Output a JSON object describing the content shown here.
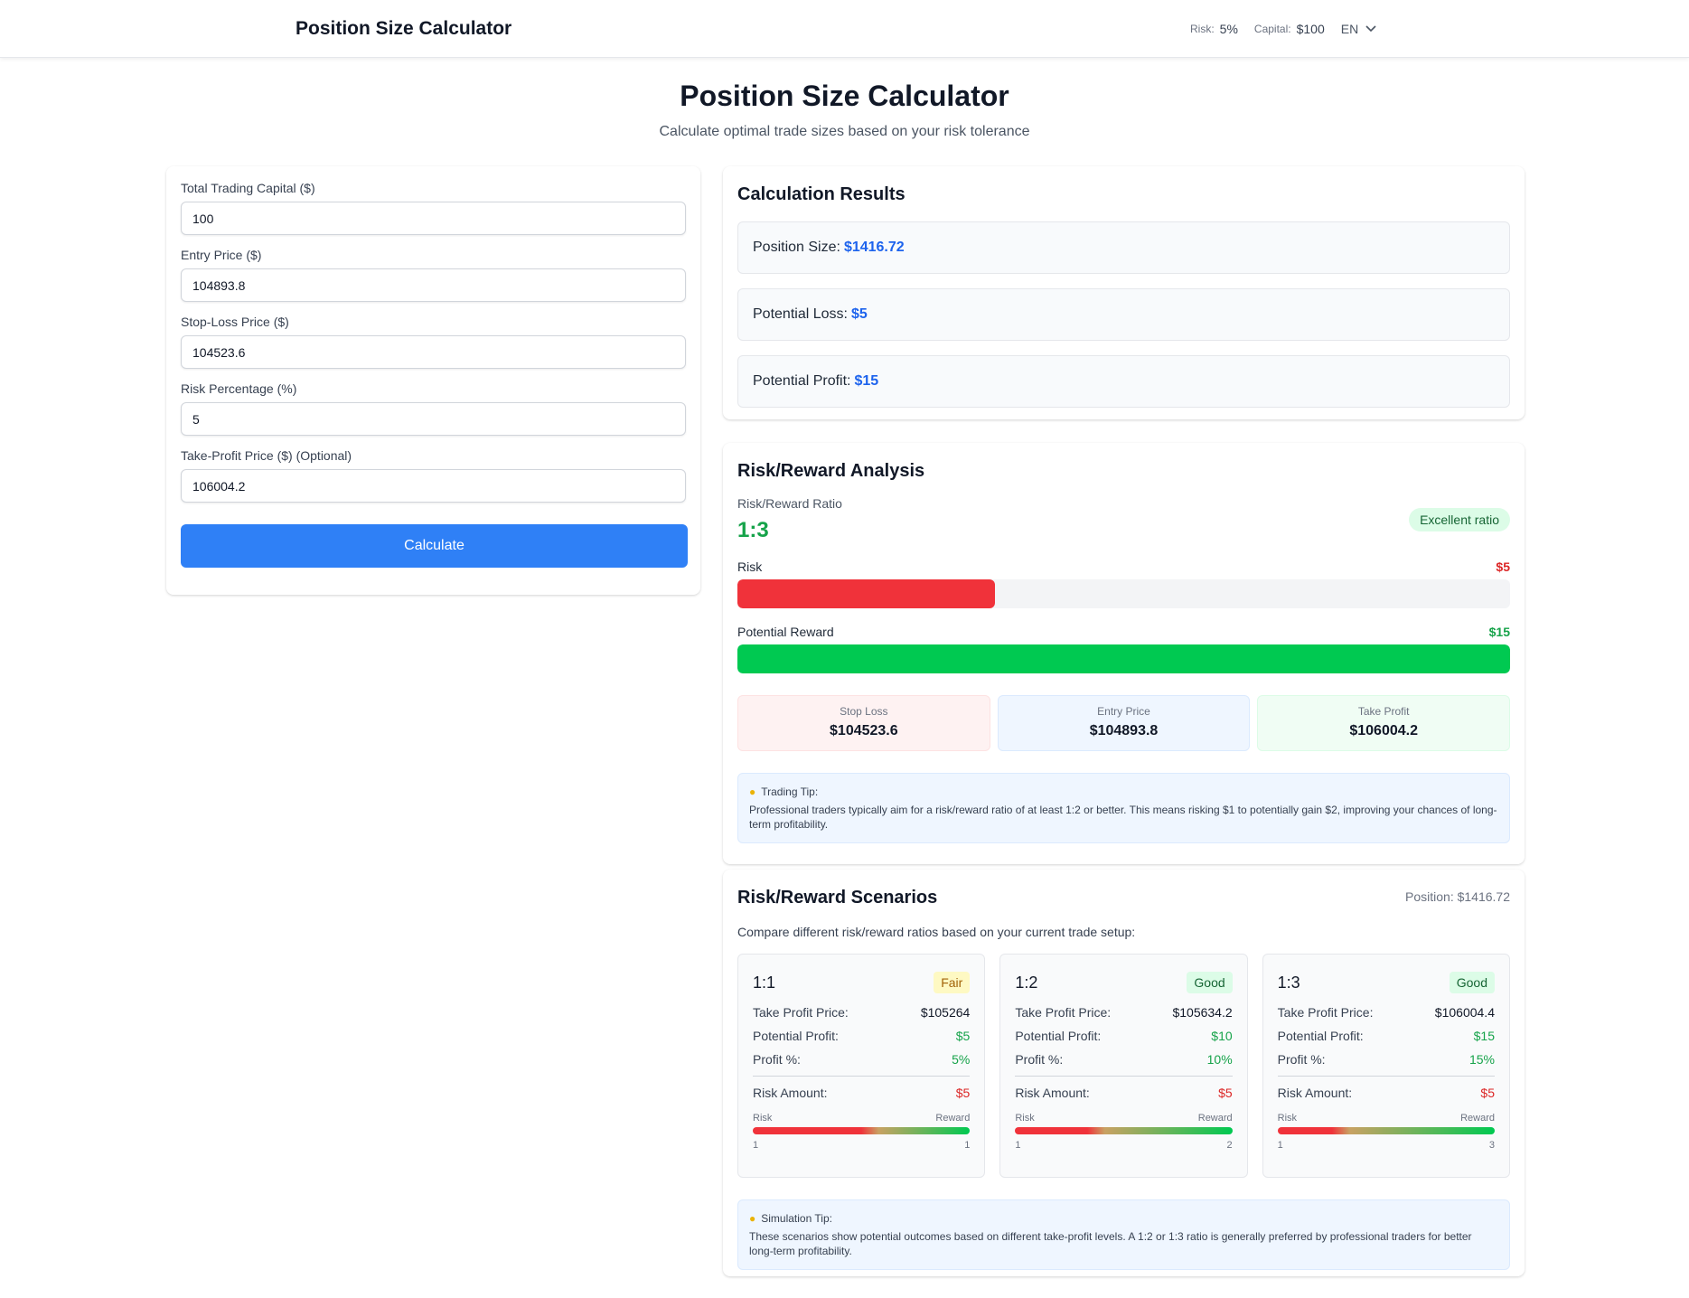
{
  "header": {
    "brand": "Position Size Calculator",
    "risk_label": "Risk:",
    "risk_value": "5%",
    "capital_label": "Capital:",
    "capital_value": "$100",
    "language": "EN"
  },
  "hero": {
    "title": "Position Size Calculator",
    "subtitle": "Calculate optimal trade sizes based on your risk tolerance"
  },
  "form": {
    "fields": [
      {
        "label": "Total Trading Capital ($)",
        "value": "100"
      },
      {
        "label": "Entry Price ($)",
        "value": "104893.8"
      },
      {
        "label": "Stop-Loss Price ($)",
        "value": "104523.6"
      },
      {
        "label": "Risk Percentage (%)",
        "value": "5"
      },
      {
        "label": "Take-Profit Price ($) (Optional)",
        "value": "106004.2"
      }
    ],
    "calculate_label": "Calculate"
  },
  "results": {
    "title": "Calculation Results",
    "rows": [
      {
        "label": "Position Size:",
        "value": "$1416.72"
      },
      {
        "label": "Potential Loss:",
        "value": "$5"
      },
      {
        "label": "Potential Profit:",
        "value": "$15"
      }
    ]
  },
  "analysis": {
    "title": "Risk/Reward Analysis",
    "ratio_label": "Risk/Reward Ratio",
    "ratio_value": "1:3",
    "ratio_badge": "Excellent ratio",
    "risk_label": "Risk",
    "risk_value": "$5",
    "risk_fill": 0.333,
    "reward_label": "Potential Reward",
    "reward_value": "$15",
    "reward_fill": 1.0,
    "stop_loss_label": "Stop Loss",
    "stop_loss_value": "$104523.6",
    "entry_label": "Entry Price",
    "entry_value": "$104893.8",
    "take_profit_label": "Take Profit",
    "take_profit_value": "$106004.2",
    "tip_title": "Trading Tip:",
    "tip_text": "Professional traders typically aim for a risk/reward ratio of at least 1:2 or better. This means risking $1 to potentially gain $2, improving your chances of long-term profitability."
  },
  "scenarios": {
    "title": "Risk/Reward Scenarios",
    "position": "Position: $1416.72",
    "description": "Compare different risk/reward ratios based on your current trade setup:",
    "labels": {
      "take_profit": "Take Profit Price:",
      "potential_profit": "Potential Profit:",
      "profit_pct": "Profit %:",
      "risk_amount": "Risk Amount:",
      "risk": "Risk",
      "reward": "Reward"
    },
    "items": [
      {
        "ratio": "1:1",
        "badge": "Fair",
        "take_profit": "$105264",
        "profit": "$5",
        "profit_pct": "5%",
        "risk_amount": "$5",
        "risk_num": "1",
        "reward_num": "1",
        "risk_fraction": 0.5
      },
      {
        "ratio": "1:2",
        "badge": "Good",
        "take_profit": "$105634.2",
        "profit": "$10",
        "profit_pct": "10%",
        "risk_amount": "$5",
        "risk_num": "1",
        "reward_num": "2",
        "risk_fraction": 0.333
      },
      {
        "ratio": "1:3",
        "badge": "Good",
        "take_profit": "$106004.4",
        "profit": "$15",
        "profit_pct": "15%",
        "risk_amount": "$5",
        "risk_num": "1",
        "reward_num": "3",
        "risk_fraction": 0.25
      }
    ],
    "tip_title": "Simulation Tip:",
    "tip_text": "These scenarios show potential outcomes based on different take-profit levels. A 1:2 or 1:3 ratio is generally preferred by professional traders for better long-term profitability."
  },
  "colors": {
    "accent": "#2f80f6",
    "value_blue": "#1d63ed",
    "risk_red": "#f0323a",
    "reward_green": "#00c951"
  }
}
